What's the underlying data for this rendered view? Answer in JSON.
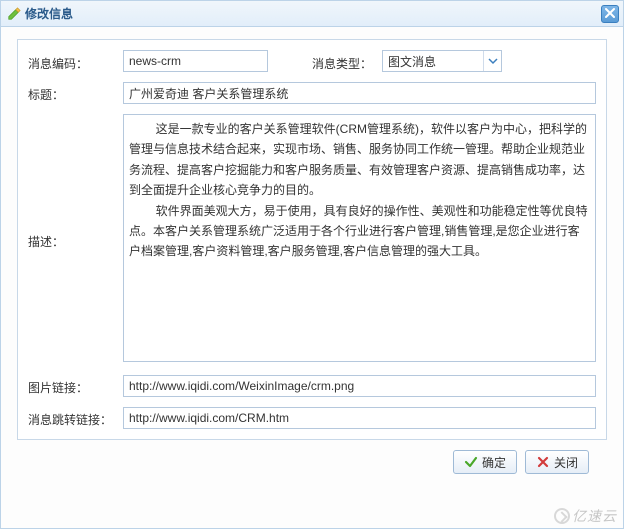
{
  "window": {
    "title": "修改信息"
  },
  "labels": {
    "msg_code": "消息编码：",
    "msg_type": "消息类型：",
    "title": "标题：",
    "description": "描述：",
    "image_link": "图片链接：",
    "jump_link": "消息跳转链接："
  },
  "fields": {
    "msg_code": "news-crm",
    "msg_type_selected": "图文消息",
    "title": "广州爱奇迪 客户关系管理系统",
    "description": "        这是一款专业的客户关系管理软件(CRM管理系统)，软件以客户为中心，把科学的管理与信息技术结合起来，实现市场、销售、服务协同工作统一管理。帮助企业规范业务流程、提高客户挖掘能力和客户服务质量、有效管理客户资源、提高销售成功率，达到全面提升企业核心竞争力的目的。\n        软件界面美观大方，易于使用，具有良好的操作性、美观性和功能稳定性等优良特点。本客户关系管理系统广泛适用于各个行业进行客户管理,销售管理,是您企业进行客户档案管理,客户资料管理,客户服务管理,客户信息管理的强大工具。",
    "image_link": "http://www.iqidi.com/WeixinImage/crm.png",
    "jump_link": "http://www.iqidi.com/CRM.htm"
  },
  "buttons": {
    "ok": "确定",
    "close": "关闭"
  },
  "watermark": "亿速云"
}
